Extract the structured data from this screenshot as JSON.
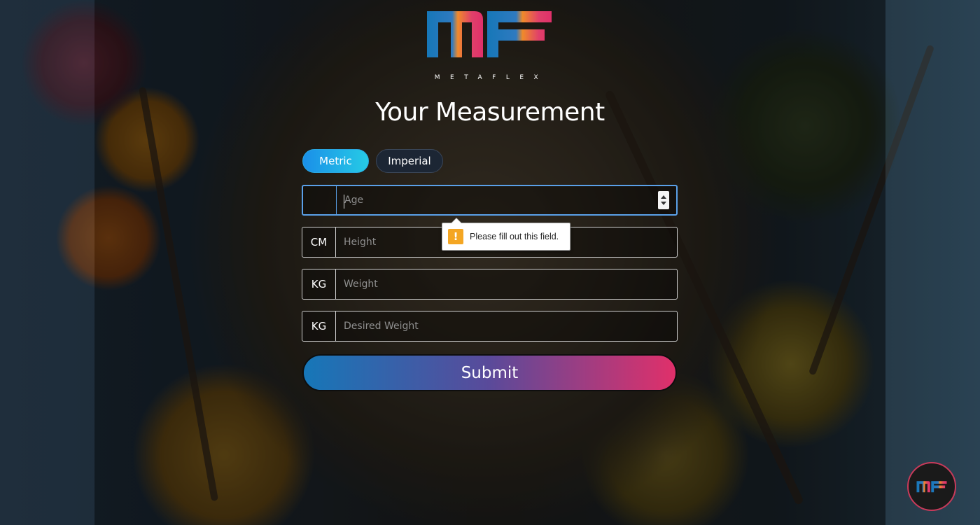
{
  "brand": {
    "name": "METAFLEX",
    "colors": {
      "blue": "#1677b8",
      "orange": "#f08a2a",
      "pink": "#e0306a"
    }
  },
  "page": {
    "title": "Your Measurement"
  },
  "units": {
    "options": [
      "Metric",
      "Imperial"
    ],
    "selected": "Metric"
  },
  "form": {
    "fields": [
      {
        "prefix": "",
        "placeholder": "Age",
        "type": "number"
      },
      {
        "prefix": "CM",
        "placeholder": "Height",
        "type": "number"
      },
      {
        "prefix": "KG",
        "placeholder": "Weight",
        "type": "number"
      },
      {
        "prefix": "KG",
        "placeholder": "Desired Weight",
        "type": "number"
      }
    ],
    "submit_label": "Submit"
  },
  "validation": {
    "message": "Please fill out this field.",
    "icon": "warning-icon"
  }
}
